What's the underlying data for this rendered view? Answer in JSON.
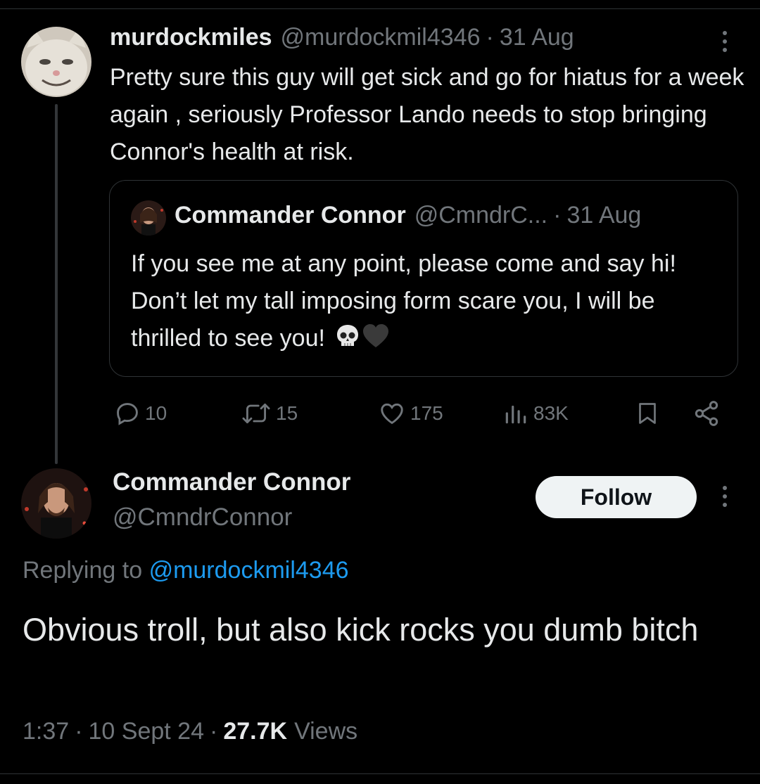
{
  "parent_tweet": {
    "display_name": "murdockmiles",
    "handle": "@murdockmil4346",
    "separator": "·",
    "date": "31 Aug",
    "text": "Pretty sure this guy will get sick and  go for hiatus for a week again , seriously Professor Lando needs to stop bringing Connor's health at risk.",
    "quoted_tweet": {
      "display_name": "Commander Connor",
      "handle": "@CmndrC...",
      "separator": "·",
      "date": "31 Aug",
      "text": "If you see me at any point, please come and say hi! Don’t let my tall imposing form scare you, I will be thrilled to see you!",
      "emojis": [
        "skull",
        "black-heart"
      ]
    },
    "actions": {
      "replies": "10",
      "reposts": "15",
      "likes": "175",
      "views": "83K"
    }
  },
  "reply_tweet": {
    "display_name": "Commander Connor",
    "handle": "@CmndrConnor",
    "follow_label": "Follow",
    "replying_label": "Replying to",
    "replying_to": "@murdockmil4346",
    "text": "Obvious troll, but also kick rocks you dumb bitch",
    "time": "1:37",
    "date": "10 Sept 24",
    "separator": "·",
    "views_count": "27.7K",
    "views_label": "Views"
  },
  "colors": {
    "background": "#000000",
    "text_primary": "#e7e9ea",
    "text_secondary": "#71767b",
    "link": "#1d9bf0",
    "divider": "#2f3336",
    "follow_button_bg": "#eff3f4"
  },
  "icons": [
    "reply-icon",
    "repost-icon",
    "like-icon",
    "views-icon",
    "bookmark-icon",
    "share-icon",
    "more-icon"
  ]
}
